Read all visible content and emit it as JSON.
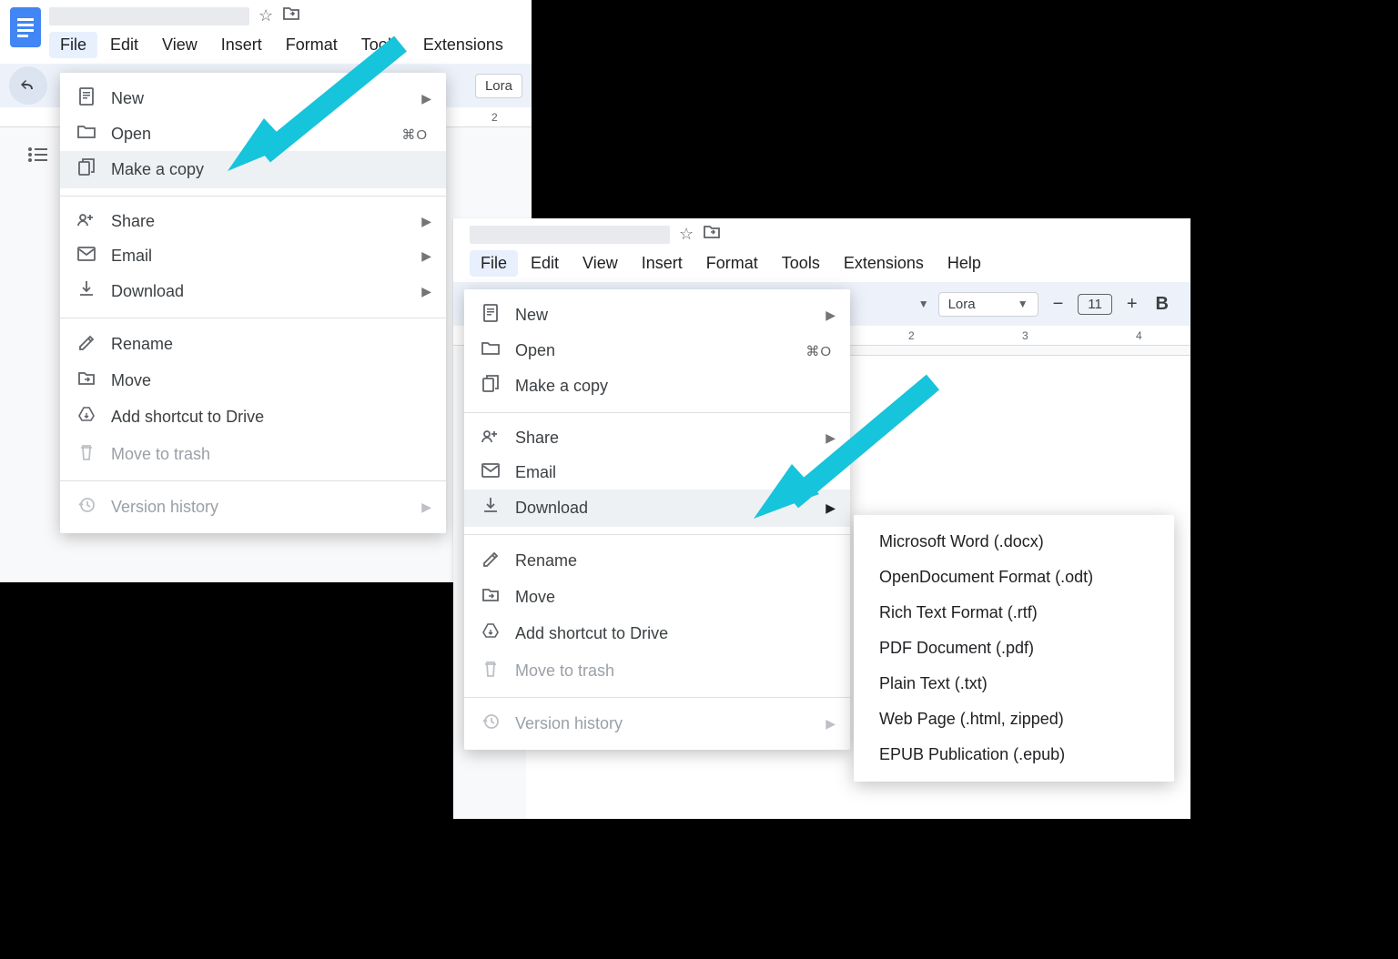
{
  "panel1": {
    "menus": [
      "File",
      "Edit",
      "View",
      "Insert",
      "Format",
      "Tools",
      "Extensions"
    ],
    "activeMenu": "File",
    "toolbar": {
      "font": "Lora"
    },
    "ruler": [
      "2"
    ],
    "fileMenu": {
      "new": "New",
      "open": "Open",
      "openShortcut": "⌘O",
      "makeCopy": "Make a copy",
      "share": "Share",
      "email": "Email",
      "download": "Download",
      "rename": "Rename",
      "move": "Move",
      "addShortcut": "Add shortcut to Drive",
      "trash": "Move to trash",
      "version": "Version history"
    }
  },
  "panel2": {
    "menus": [
      "File",
      "Edit",
      "View",
      "Insert",
      "Format",
      "Tools",
      "Extensions",
      "Help"
    ],
    "activeMenu": "File",
    "toolbar": {
      "font": "Lora",
      "size": "11"
    },
    "ruler": [
      "2",
      "3",
      "4"
    ],
    "fileMenu": {
      "new": "New",
      "open": "Open",
      "openShortcut": "⌘O",
      "makeCopy": "Make a copy",
      "share": "Share",
      "email": "Email",
      "download": "Download",
      "rename": "Rename",
      "move": "Move",
      "addShortcut": "Add shortcut to Drive",
      "trash": "Move to trash",
      "version": "Version history"
    },
    "downloadSub": [
      "Microsoft Word (.docx)",
      "OpenDocument Format (.odt)",
      "Rich Text Format (.rtf)",
      "PDF Document (.pdf)",
      "Plain Text (.txt)",
      "Web Page (.html, zipped)",
      "EPUB Publication (.epub)"
    ]
  }
}
